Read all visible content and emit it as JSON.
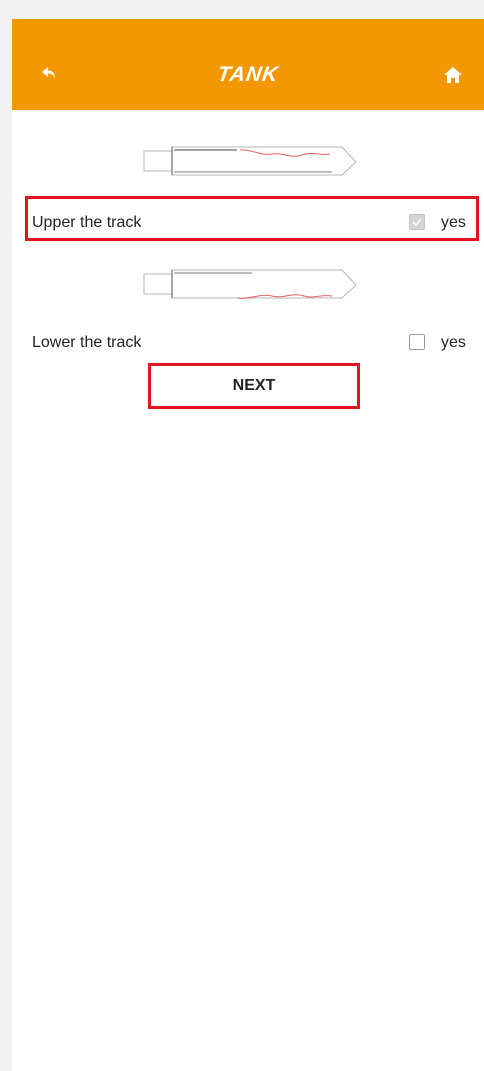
{
  "header": {
    "title": "TANK",
    "back_icon": "back-arrow-icon",
    "home_icon": "home-icon",
    "background_color": "#f39800"
  },
  "options": [
    {
      "label": "Upper the track",
      "checkbox_label": "yes",
      "checked": true
    },
    {
      "label": "Lower the track",
      "checkbox_label": "yes",
      "checked": false
    }
  ],
  "next_button": {
    "label": "NEXT"
  },
  "highlight_color": "#e3141c"
}
